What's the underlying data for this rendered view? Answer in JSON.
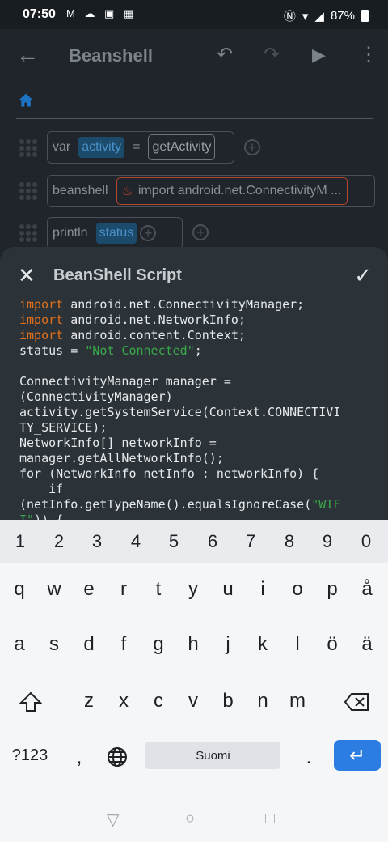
{
  "status_bar": {
    "time": "07:50",
    "left_icons": "M ☁ ▣ ▦",
    "battery": "87%"
  },
  "app_bar": {
    "title": "Beanshell"
  },
  "blocks": [
    {
      "keyword": "var",
      "chip": "activity",
      "op": "=",
      "value": "getActivity"
    },
    {
      "keyword": "beanshell",
      "value": "import android.net.ConnectivityM ..."
    },
    {
      "keyword": "println",
      "chip": "status"
    }
  ],
  "sheet": {
    "title": "BeanShell Script",
    "code_lines": [
      [
        [
          "kw",
          "import"
        ],
        [
          "t",
          " android.net.ConnectivityManager;"
        ]
      ],
      [
        [
          "kw",
          "import"
        ],
        [
          "t",
          " android.net.NetworkInfo;"
        ]
      ],
      [
        [
          "kw",
          "import"
        ],
        [
          "t",
          " android.content.Context;"
        ]
      ],
      [
        [
          "t",
          "status = "
        ],
        [
          "str",
          "\"Not Connected\""
        ],
        [
          "t",
          ";"
        ]
      ],
      [
        [
          "t",
          ""
        ]
      ],
      [
        [
          "t",
          "ConnectivityManager manager ="
        ]
      ],
      [
        [
          "t",
          "(ConnectivityManager)"
        ]
      ],
      [
        [
          "t",
          "activity.getSystemService(Context.CONNECTIVI"
        ]
      ],
      [
        [
          "t",
          "TY_SERVICE);"
        ]
      ],
      [
        [
          "t",
          "NetworkInfo[] networkInfo ="
        ]
      ],
      [
        [
          "t",
          "manager.getAllNetworkInfo();"
        ]
      ],
      [
        [
          "t",
          "for (NetworkInfo netInfo : networkInfo) {"
        ]
      ],
      [
        [
          "t",
          "    if"
        ]
      ],
      [
        [
          "t",
          "(netInfo.getTypeName().equalsIgnoreCase("
        ],
        [
          "str",
          "\"WIF"
        ]
      ],
      [
        [
          "str",
          "I\""
        ],
        [
          "t",
          ")) {"
        ]
      ]
    ]
  },
  "keyboard": {
    "numbers": [
      "1",
      "2",
      "3",
      "4",
      "5",
      "6",
      "7",
      "8",
      "9",
      "0"
    ],
    "row1": [
      "q",
      "w",
      "e",
      "r",
      "t",
      "y",
      "u",
      "i",
      "o",
      "p",
      "å"
    ],
    "row2": [
      "a",
      "s",
      "d",
      "f",
      "g",
      "h",
      "j",
      "k",
      "l",
      "ö",
      "ä"
    ],
    "row3": [
      "z",
      "x",
      "c",
      "v",
      "b",
      "n",
      "m"
    ],
    "symbols_label": "?123",
    "comma": ",",
    "space_label": "Suomi",
    "period": "."
  },
  "icons": {
    "back": "arrow-left-icon",
    "undo": "undo-icon",
    "redo": "redo-icon",
    "run": "play-icon",
    "menu": "more-vert-icon",
    "home": "home-icon",
    "close": "close-icon",
    "confirm": "check-icon",
    "shift": "shift-icon",
    "backspace": "backspace-icon",
    "language": "globe-icon",
    "enter": "enter-icon"
  }
}
